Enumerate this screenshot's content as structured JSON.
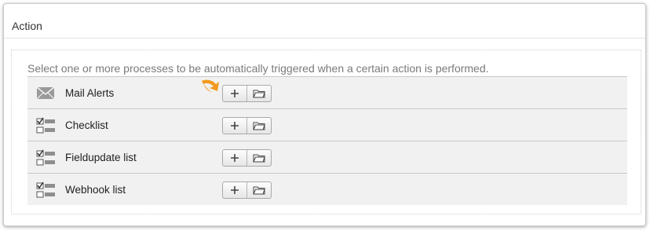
{
  "section": {
    "title": "Action"
  },
  "hint": "Select one or more processes to be automatically triggered when a certain action is performed.",
  "rows": [
    {
      "label": "Mail Alerts",
      "icon": "mail-icon"
    },
    {
      "label": "Checklist",
      "icon": "checklist-icon"
    },
    {
      "label": "Fieldupdate list",
      "icon": "checklist-icon"
    },
    {
      "label": "Webhook list",
      "icon": "checklist-icon"
    }
  ],
  "buttons": {
    "add_icon": "plus-icon",
    "browse_icon": "folder-icon"
  },
  "colors": {
    "accent_arrow": "#f39a1e",
    "row_bg": "#f1f1f1"
  }
}
